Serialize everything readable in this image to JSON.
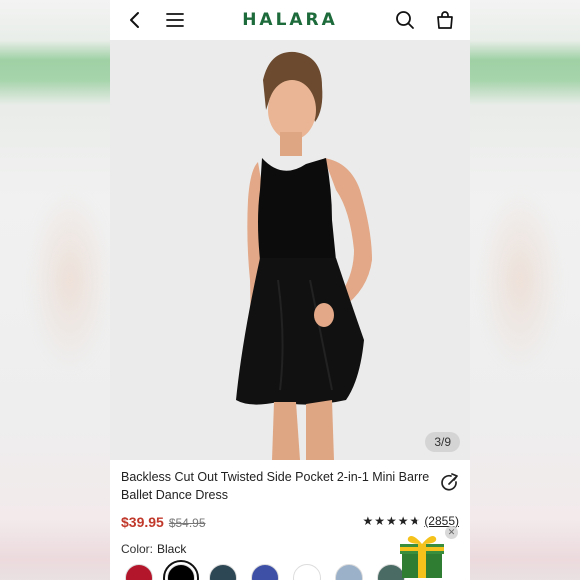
{
  "header": {
    "brand": "HALARA",
    "back_icon": "chevron-left-icon",
    "menu_icon": "hamburger-menu-icon",
    "search_icon": "search-icon",
    "cart_icon": "shopping-bag-icon"
  },
  "gallery": {
    "counter": "3/9",
    "image_alt": "Model wearing black backless cut out mini dress"
  },
  "product": {
    "title": "Backless Cut Out Twisted Side Pocket 2-in-1 Mini Barre Ballet Dance Dress",
    "price": "$39.95",
    "original_price": "$54.95",
    "rating": 4.7,
    "review_count": "(2855)",
    "color_label": "Color:",
    "color_value": "Black",
    "swatches": [
      {
        "color": "#b3162b",
        "selected": false
      },
      {
        "color": "#000000",
        "selected": true
      },
      {
        "color": "#2d4754",
        "selected": false
      },
      {
        "color": "#3e4fa6",
        "selected": false
      },
      {
        "color": "#ffffff",
        "selected": false
      },
      {
        "color": "#9bb1c9",
        "selected": false
      },
      {
        "color": "#4a6b63",
        "selected": false
      }
    ]
  },
  "colors": {
    "brand": "#1d6a3a",
    "sale_price": "#c0392b"
  }
}
